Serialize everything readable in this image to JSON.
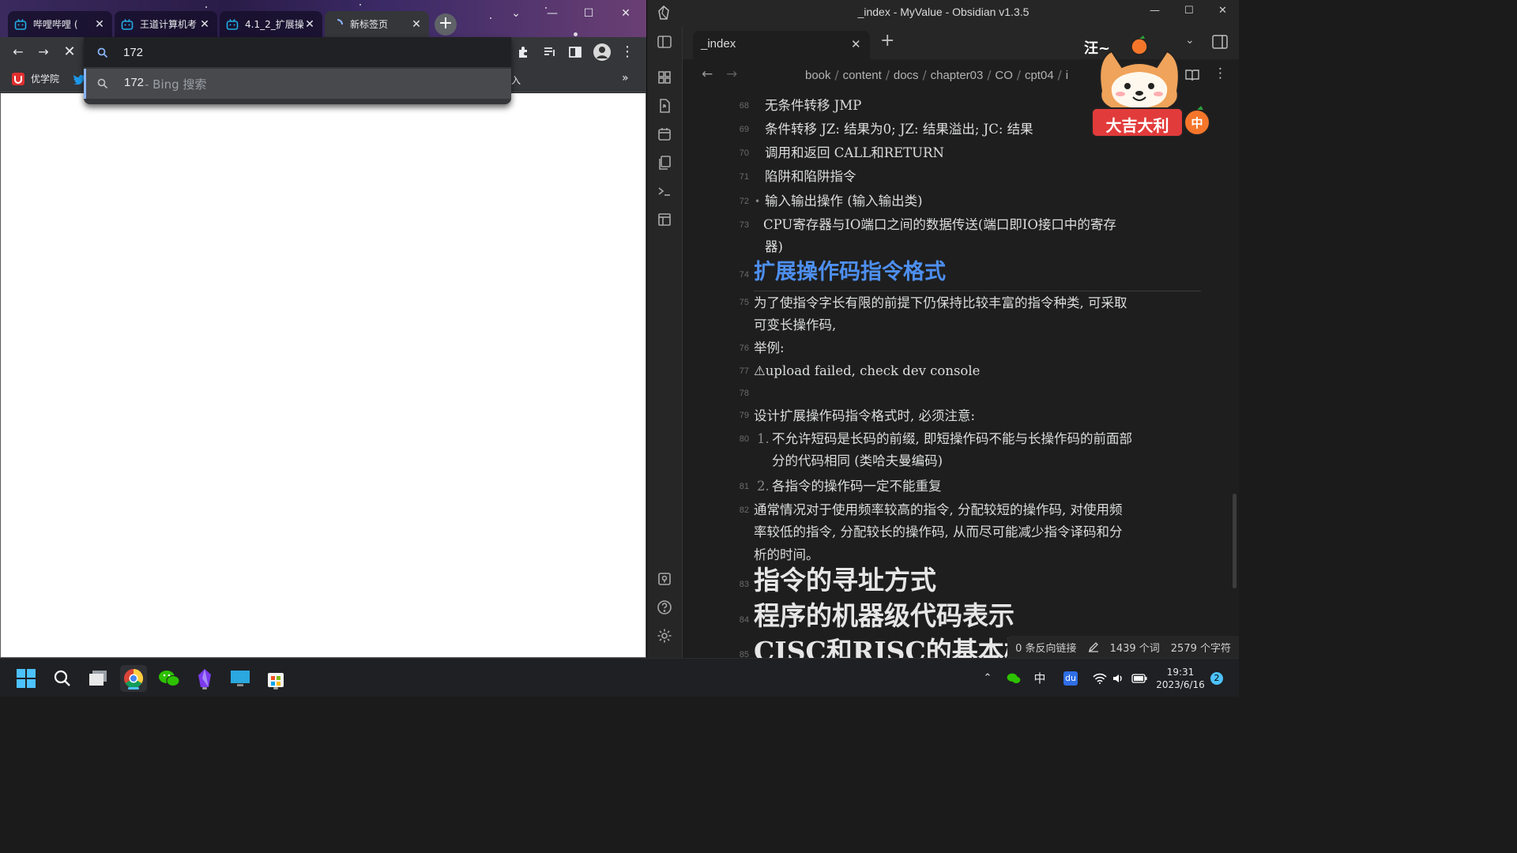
{
  "chrome": {
    "tabs": [
      {
        "label": "哔哩哔哩 (",
        "active": false
      },
      {
        "label": "王道计算机考",
        "active": false
      },
      {
        "label": "4.1_2_扩展操",
        "active": false
      },
      {
        "label": "新标签页",
        "active": true
      }
    ],
    "close_glyph": "✕",
    "new_tab_glyph": "+",
    "window_controls": {
      "minimize": "—",
      "maximize": "☐",
      "close": "✕",
      "tab_search": "⌄"
    },
    "omnibox": {
      "value": "172"
    },
    "suggestion": {
      "query": "172",
      "suffix": " - Bing 搜索"
    },
    "bookmarks": {
      "first_label": "优学院",
      "overflow_hint": "入",
      "more": "»"
    }
  },
  "obsidian": {
    "window_title": "_index - MyValue - Obsidian v1.3.5",
    "tab_title": "_index",
    "breadcrumb": [
      "book",
      "content",
      "docs",
      "chapter03",
      "CO",
      "cpt04",
      "i"
    ],
    "lines": [
      {
        "num": "68",
        "text": "无条件转移 JMP"
      },
      {
        "num": "69",
        "text": "条件转移 JZ: 结果为0; JZ: 结果溢出; JC: 结果"
      },
      {
        "num": "70",
        "text": "调用和返回 CALL和RETURN"
      },
      {
        "num": "71",
        "text": "陷阱和陷阱指令"
      },
      {
        "num": "72",
        "text": "输入输出操作 (输入输出类)"
      },
      {
        "num": "73",
        "text": "CPU寄存器与IO端口之间的数据传送(端口即IO接口中的寄存",
        "cont": "器)"
      },
      {
        "num": "74",
        "text": "扩展操作码指令格式"
      },
      {
        "num": "75",
        "text": "为了使指令字长有限的前提下仍保持比较丰富的指令种类, 可采取",
        "cont": "可变长操作码,"
      },
      {
        "num": "76",
        "text": "举例:"
      },
      {
        "num": "77",
        "text": "upload failed, check dev console"
      },
      {
        "num": "78",
        "text": ""
      },
      {
        "num": "79",
        "text": "设计扩展操作码指令格式时, 必须注意:"
      },
      {
        "num": "80",
        "marker": "1.",
        "text": "不允许短码是长码的前缀, 即短操作码不能与长操作码的前面部",
        "cont": "分的代码相同 (类哈夫曼编码)"
      },
      {
        "num": "81",
        "marker": "2.",
        "text": "各指令的操作码一定不能重复"
      },
      {
        "num": "82",
        "text": "通常情况对于使用频率较高的指令, 分配较短的操作码, 对使用频",
        "cont": "率较低的指令, 分配较长的操作码, 从而尽可能减少指令译码和分",
        "cont2": "析的时间。"
      },
      {
        "num": "83",
        "text": "指令的寻址方式"
      },
      {
        "num": "84",
        "text": "程序的机器级代码表示"
      },
      {
        "num": "85",
        "text": "CISC和RISC的基本概"
      }
    ],
    "status": {
      "backlinks": "0 条反向链接",
      "words": "1439 个词",
      "chars": "2579 个字符"
    },
    "mascot_text": "大吉大利",
    "mascot_badge": "中",
    "mascot_sign": "汪~"
  },
  "taskbar": {
    "ime": "中",
    "time": "19:31",
    "date": "2023/6/16",
    "notifications": "2",
    "baidu": "du"
  },
  "colors": {
    "heading_blue": "#4d8ff0",
    "accent": "#4cc2ff"
  }
}
